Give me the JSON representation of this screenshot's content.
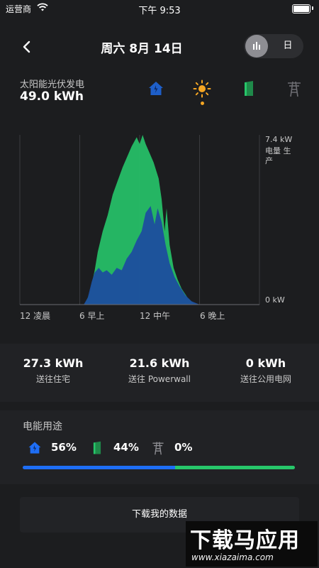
{
  "status_bar": {
    "carrier": "运营商",
    "time": "下午 9:53"
  },
  "header": {
    "title": "周六 8月 14日",
    "toggle_day_label": "日"
  },
  "solar": {
    "label": "太阳能光伏发电",
    "value": "49.0 kWh"
  },
  "chart_data": {
    "type": "area",
    "x": [
      0,
      1,
      2,
      3,
      4,
      5,
      6,
      7,
      8,
      9,
      10,
      11,
      12,
      13,
      14,
      15,
      16,
      17,
      18,
      19,
      20,
      21,
      22,
      23,
      24
    ],
    "xlim": [
      0,
      24
    ],
    "ylim": [
      0,
      7.4
    ],
    "y_unit": "kW",
    "ylabel": "电量 生产",
    "y_tick_labels": [
      "7.4 kW",
      "0 kW"
    ],
    "x_tick_labels": [
      "12 凌晨",
      "6 早上",
      "12 中午",
      "6 晚上"
    ],
    "series": [
      {
        "name": "",
        "color": "#27c76a",
        "points": [
          [
            0,
            0
          ],
          [
            6.5,
            0
          ],
          [
            7,
            0.5
          ],
          [
            7.5,
            1.5
          ],
          [
            7.8,
            2.3
          ],
          [
            8.3,
            3.2
          ],
          [
            8.8,
            3.9
          ],
          [
            9.3,
            4.8
          ],
          [
            9.8,
            5.4
          ],
          [
            10.3,
            6.0
          ],
          [
            10.8,
            6.5
          ],
          [
            11.2,
            6.9
          ],
          [
            11.7,
            7.3
          ],
          [
            12,
            7.0
          ],
          [
            12.3,
            7.4
          ],
          [
            12.6,
            7.0
          ],
          [
            13,
            6.6
          ],
          [
            13.4,
            6.2
          ],
          [
            13.9,
            5.5
          ],
          [
            14.2,
            4.6
          ],
          [
            14.5,
            3.2
          ],
          [
            14.7,
            4.2
          ],
          [
            15,
            2.6
          ],
          [
            15.4,
            1.6
          ],
          [
            15.8,
            1.1
          ],
          [
            16.2,
            0.7
          ],
          [
            16.8,
            0.3
          ],
          [
            17.4,
            0.05
          ],
          [
            18,
            0
          ],
          [
            24,
            0
          ]
        ]
      },
      {
        "name": "",
        "color": "#1c4e9e",
        "points": [
          [
            0,
            0
          ],
          [
            6.4,
            0
          ],
          [
            6.8,
            0.3
          ],
          [
            7.2,
            1.0
          ],
          [
            7.5,
            1.4
          ],
          [
            7.9,
            1.6
          ],
          [
            8.3,
            1.4
          ],
          [
            8.7,
            1.5
          ],
          [
            9.2,
            1.3
          ],
          [
            9.7,
            1.6
          ],
          [
            10.2,
            1.5
          ],
          [
            10.7,
            2.0
          ],
          [
            11.2,
            2.3
          ],
          [
            11.7,
            2.8
          ],
          [
            12.2,
            3.2
          ],
          [
            12.6,
            4.0
          ],
          [
            13.1,
            4.3
          ],
          [
            13.5,
            3.5
          ],
          [
            13.8,
            4.2
          ],
          [
            14.2,
            3.6
          ],
          [
            14.6,
            2.6
          ],
          [
            15,
            1.8
          ],
          [
            15.5,
            1.2
          ],
          [
            16,
            0.8
          ],
          [
            16.6,
            0.4
          ],
          [
            17.2,
            0.15
          ],
          [
            18,
            0
          ],
          [
            24,
            0
          ]
        ]
      }
    ]
  },
  "stats": [
    {
      "value": "27.3 kWh",
      "label": "送往住宅"
    },
    {
      "value": "21.6 kWh",
      "label": "送往 Powerwall"
    },
    {
      "value": "0 kWh",
      "label": "送往公用电网"
    }
  ],
  "usage": {
    "title": "电能用途",
    "home_pct": "56%",
    "powerwall_pct": "44%",
    "grid_pct": "0%",
    "home_fraction": 0.56,
    "powerwall_fraction": 0.44,
    "colors": {
      "home": "#1e6ef5",
      "powerwall": "#27c76a",
      "grid": "#8e8e93"
    }
  },
  "download_label": "下载我的数据",
  "watermark": {
    "line1": "下载马应用",
    "line2": "www.xiazaima.com"
  },
  "icons": {
    "back": "chevron-left-icon",
    "chart": "bar-chart-icon",
    "home": "home-icon",
    "sun": "sun-icon",
    "powerwall": "battery-icon",
    "grid": "power-tower-icon"
  }
}
